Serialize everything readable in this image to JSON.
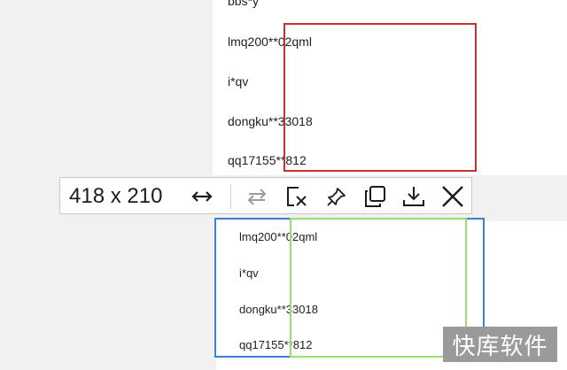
{
  "upper_list": [
    "bbs*y",
    "lmq200**02qml",
    "i*qv",
    "dongku**33018",
    "qq17155**812"
  ],
  "lower_list": [
    "lmq200**02qml",
    "i*qv",
    "dongku**33018",
    "qq17155**812"
  ],
  "toolbar": {
    "size_readout": "418 x 210",
    "icons": [
      "resize-arrows-icon",
      "swap-arrows-icon",
      "cancel-selection-icon",
      "pin-icon",
      "copy-icon",
      "download-icon",
      "close-icon"
    ]
  },
  "colors": {
    "red_selection": "#c4322e",
    "blue_selection": "#3b7fd6",
    "green_selection": "#99e06d"
  },
  "watermark": "快库软件"
}
